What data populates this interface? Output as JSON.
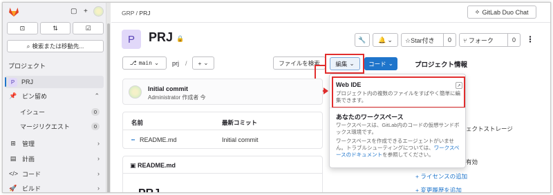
{
  "sidebar": {
    "buttons": [
      "⊡",
      "⇅",
      "☑"
    ],
    "search_label": "検索または移動先...",
    "section_label": "プロジェクト",
    "items": [
      {
        "label": "PRJ",
        "badge": "P"
      },
      {
        "label": "ピン留め"
      },
      {
        "label": "イシュー",
        "count": "0"
      },
      {
        "label": "マージリクエスト",
        "count": "0"
      },
      {
        "label": "管理"
      },
      {
        "label": "計画"
      },
      {
        "label": "コード"
      },
      {
        "label": "ビルド"
      }
    ]
  },
  "header": {
    "breadcrumb_group": "GRP",
    "breadcrumb_sep": "/",
    "breadcrumb_project": "PRJ",
    "duo_chat": "GitLab Duo Chat"
  },
  "project": {
    "avatar_letter": "P",
    "title": "PRJ",
    "star_label": "Star付き",
    "star_count": "0",
    "fork_label": "フォーク",
    "fork_count": "0"
  },
  "toolbar": {
    "branch": "main",
    "path": "prj",
    "path_sep": "/",
    "plus": "+",
    "find_file": "ファイルを検索",
    "edit": "編集",
    "code": "コード",
    "project_info": "プロジェクト情報"
  },
  "commit": {
    "title": "Initial commit",
    "meta": "Administrator 作成者 今"
  },
  "files": {
    "col_name": "名前",
    "col_commit": "最新コミット",
    "rows": [
      {
        "name": "README.md",
        "commit": "Initial commit"
      }
    ]
  },
  "readme": {
    "header": "README.md",
    "heading": "PRJ"
  },
  "right_panel": {
    "storage_fragment": "ェクトストレージ",
    "enabled_fragment": "有効",
    "add_license": "ライセンスの追加",
    "add_changelog": "変更履歴を追加"
  },
  "dropdown": {
    "webide_title": "Web IDE",
    "webide_desc": "プロジェクト内の複数のファイルをすばやく簡単に編集できます。",
    "workspace_title": "あなたのワークスペース",
    "workspace_p1": "ワークスペースは、GitLab内のコードの仮想サンドボックス環境です。",
    "workspace_p2_pre": "ワークスペースを作成できるエージェントがいません。トラブルシューティングについては、",
    "workspace_link": "ワークスペースのドキュメント",
    "workspace_p2_post": "を参照してください。"
  },
  "colors": {
    "accent": "#1f75cb",
    "highlight": "#e12d2d",
    "avatar_bg": "#e1d8f9"
  }
}
